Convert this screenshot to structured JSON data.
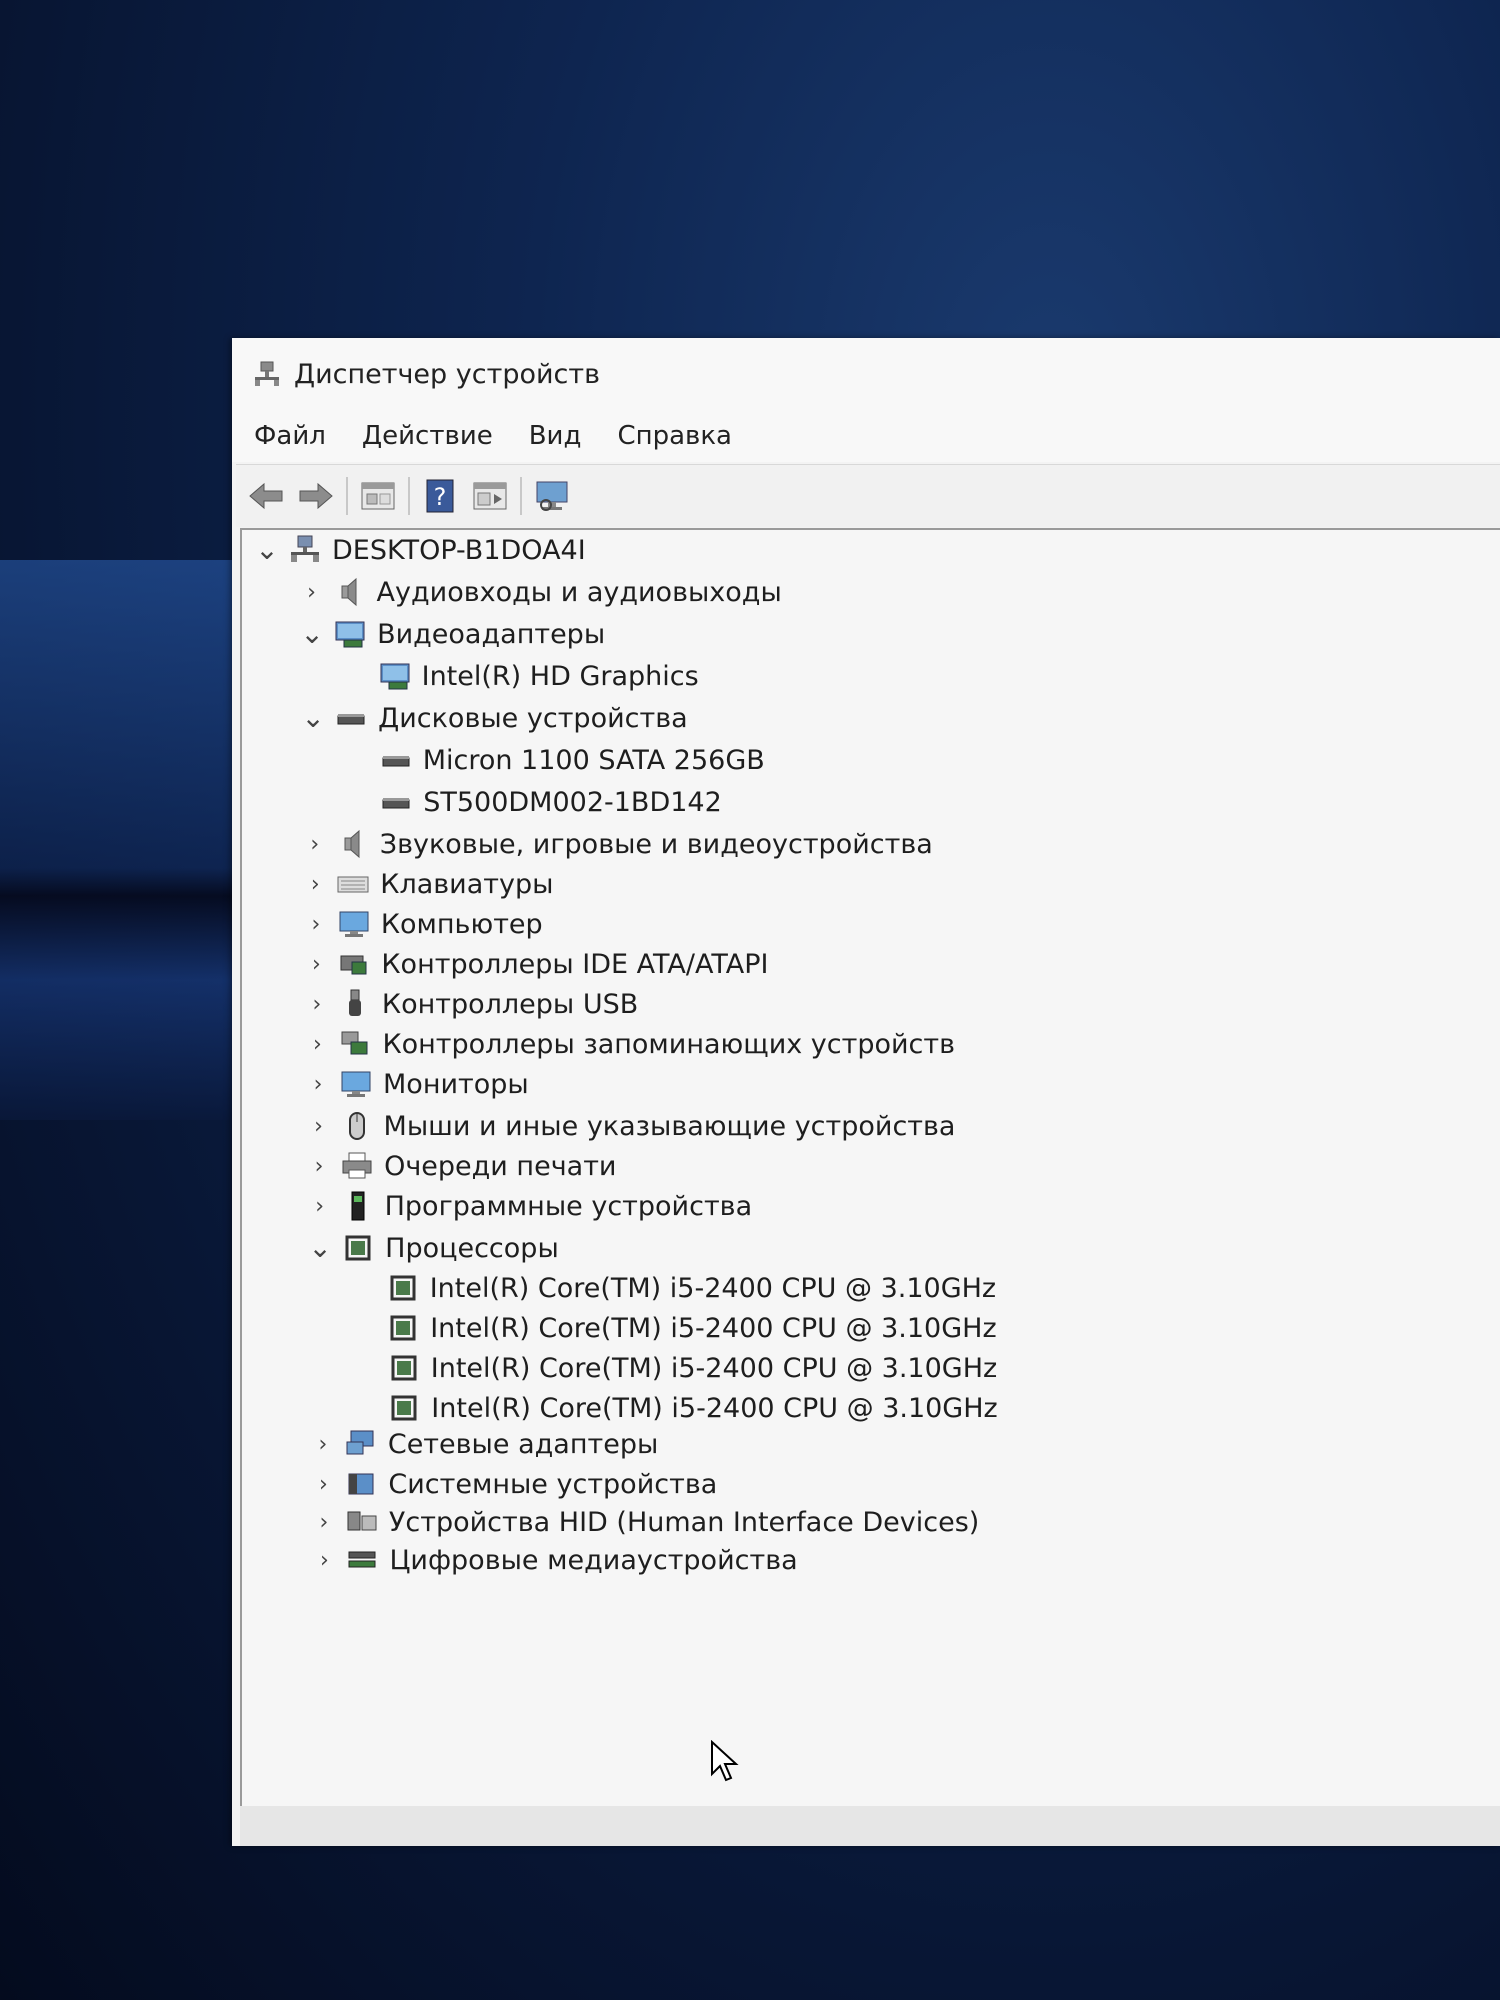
{
  "window": {
    "title": "Диспетчер устройств"
  },
  "menu": [
    {
      "label": "Файл"
    },
    {
      "label": "Действие"
    },
    {
      "label": "Вид"
    },
    {
      "label": "Справка"
    }
  ],
  "toolbar": [
    {
      "icon": "back-arrow-icon"
    },
    {
      "icon": "forward-arrow-icon"
    },
    {
      "icon": "properties-icon"
    },
    {
      "icon": "help-icon"
    },
    {
      "icon": "update-driver-icon"
    },
    {
      "icon": "monitor-scan-icon"
    }
  ],
  "tree": {
    "root": {
      "label": "DESKTOP-B1DOA4I",
      "expanded": true,
      "icon": "computer-network-icon"
    },
    "items": [
      {
        "label": "Аудиовходы и аудиовыходы",
        "expanded": false,
        "icon": "speaker-icon"
      },
      {
        "label": "Видеоадаптеры",
        "expanded": true,
        "icon": "display-adapter-icon",
        "children": [
          {
            "label": "Intel(R) HD Graphics",
            "icon": "display-adapter-icon"
          }
        ]
      },
      {
        "label": "Дисковые устройства",
        "expanded": true,
        "icon": "disk-drive-icon",
        "children": [
          {
            "label": "Micron 1100 SATA 256GB",
            "icon": "disk-drive-icon"
          },
          {
            "label": "ST500DM002-1BD142",
            "icon": "disk-drive-icon"
          }
        ]
      },
      {
        "label": "Звуковые, игровые и видеоустройства",
        "expanded": false,
        "icon": "speaker-icon"
      },
      {
        "label": "Клавиатуры",
        "expanded": false,
        "icon": "keyboard-icon"
      },
      {
        "label": "Компьютер",
        "expanded": false,
        "icon": "monitor-icon"
      },
      {
        "label": "Контроллеры IDE ATA/ATAPI",
        "expanded": false,
        "icon": "ide-controller-icon"
      },
      {
        "label": "Контроллеры USB",
        "expanded": false,
        "icon": "usb-icon"
      },
      {
        "label": "Контроллеры запоминающих устройств",
        "expanded": false,
        "icon": "storage-controller-icon"
      },
      {
        "label": "Мониторы",
        "expanded": false,
        "icon": "monitor-icon"
      },
      {
        "label": "Мыши и иные указывающие устройства",
        "expanded": false,
        "icon": "mouse-icon"
      },
      {
        "label": "Очереди печати",
        "expanded": false,
        "icon": "printer-icon"
      },
      {
        "label": "Программные устройства",
        "expanded": false,
        "icon": "software-device-icon"
      },
      {
        "label": "Процессоры",
        "expanded": true,
        "icon": "processor-icon",
        "children": [
          {
            "label": "Intel(R) Core(TM) i5-2400 CPU @ 3.10GHz",
            "icon": "processor-icon"
          },
          {
            "label": "Intel(R) Core(TM) i5-2400 CPU @ 3.10GHz",
            "icon": "processor-icon"
          },
          {
            "label": "Intel(R) Core(TM) i5-2400 CPU @ 3.10GHz",
            "icon": "processor-icon"
          },
          {
            "label": "Intel(R) Core(TM) i5-2400 CPU @ 3.10GHz",
            "icon": "processor-icon"
          }
        ]
      },
      {
        "label": "Сетевые адаптеры",
        "expanded": false,
        "icon": "network-adapter-icon"
      },
      {
        "label": "Системные устройства",
        "expanded": false,
        "icon": "system-device-icon"
      },
      {
        "label": "Устройства HID (Human Interface Devices)",
        "expanded": false,
        "icon": "hid-icon"
      },
      {
        "label": "Цифровые медиаустройства",
        "expanded": false,
        "icon": "media-device-icon"
      }
    ]
  }
}
